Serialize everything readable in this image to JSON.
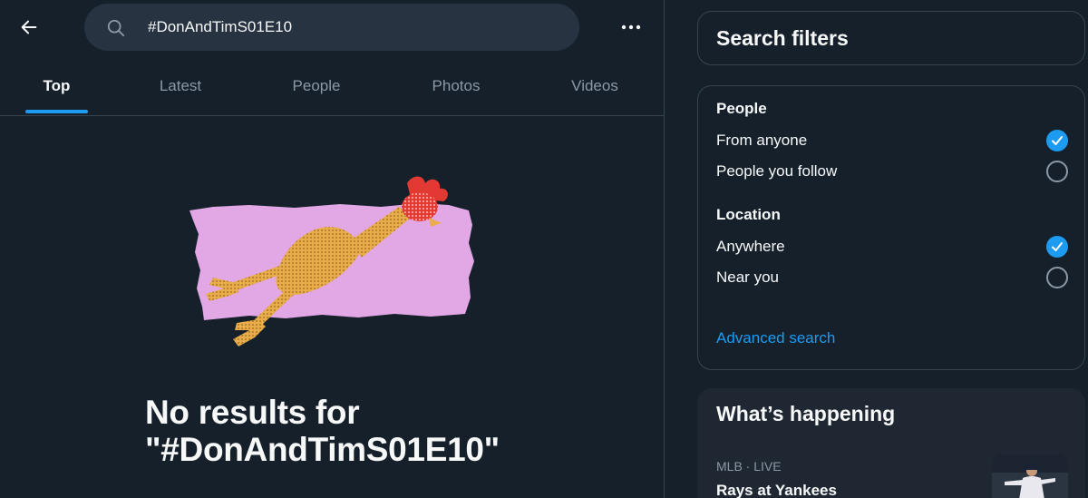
{
  "header": {
    "search_value": "#DonAndTimS01E10",
    "icons": {
      "back": "arrow-left-icon",
      "search": "search-icon",
      "more": "more-horizontal-icon"
    }
  },
  "tabs": [
    {
      "label": "Top",
      "active": true
    },
    {
      "label": "Latest",
      "active": false
    },
    {
      "label": "People",
      "active": false
    },
    {
      "label": "Photos",
      "active": false
    },
    {
      "label": "Videos",
      "active": false
    }
  ],
  "empty_state": {
    "message": "No results for \"#DonAndTimS01E10\""
  },
  "search_filters": {
    "title": "Search filters",
    "people": {
      "title": "People",
      "options": [
        {
          "label": "From anyone",
          "selected": true
        },
        {
          "label": "People you follow",
          "selected": false
        }
      ]
    },
    "location": {
      "title": "Location",
      "options": [
        {
          "label": "Anywhere",
          "selected": true
        },
        {
          "label": "Near you",
          "selected": false
        }
      ]
    },
    "advanced_link": "Advanced search"
  },
  "whats_happening": {
    "title": "What’s happening",
    "trend": {
      "meta": "MLB · LIVE",
      "title": "Rays at Yankees"
    }
  },
  "colors": {
    "background": "#15202b",
    "accent": "#1d9bf0",
    "border": "#38444d",
    "muted_text": "#8b98a5",
    "search_bg": "#273340",
    "illustration_pink": "#e2a8e6"
  }
}
